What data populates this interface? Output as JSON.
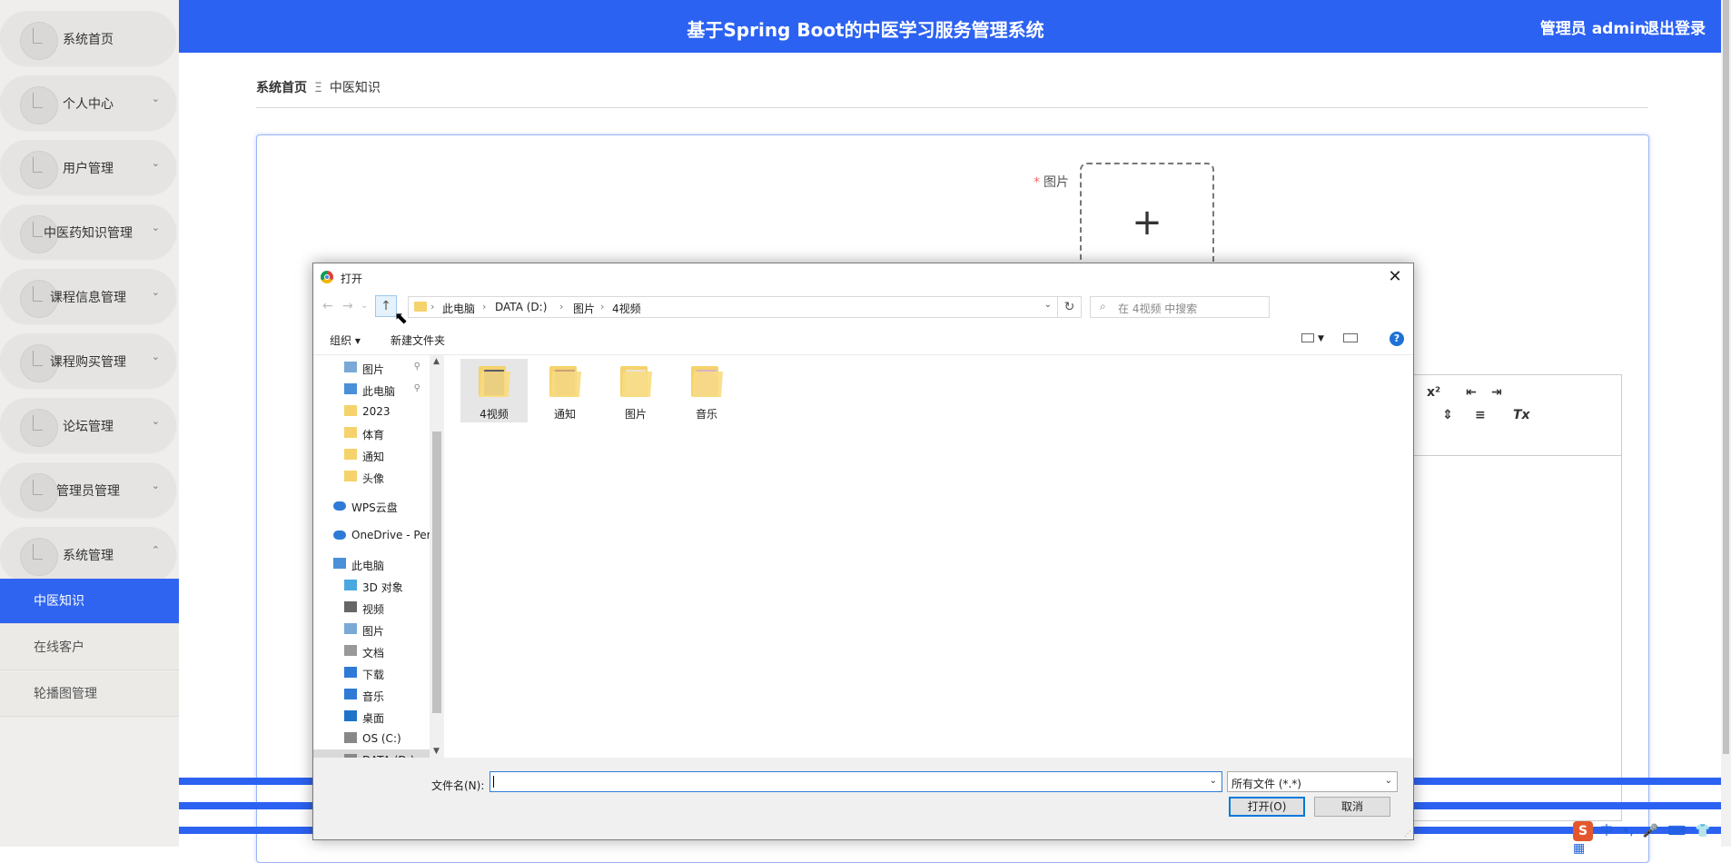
{
  "sidebar": {
    "menus": [
      {
        "label": "系统首页",
        "chevron": ""
      },
      {
        "label": "个人中心",
        "chevron": "⌄"
      },
      {
        "label": "用户管理",
        "chevron": "⌄"
      },
      {
        "label": "中医药知识管理",
        "chevron": "⌄"
      },
      {
        "label": "课程信息管理",
        "chevron": "⌄"
      },
      {
        "label": "课程购买管理",
        "chevron": "⌄"
      },
      {
        "label": "论坛管理",
        "chevron": "⌄"
      },
      {
        "label": "管理员管理",
        "chevron": "⌄"
      },
      {
        "label": "系统管理",
        "chevron": "⌃"
      }
    ],
    "subitems": [
      {
        "label": "中医知识",
        "active": true
      },
      {
        "label": "在线客户",
        "active": false
      },
      {
        "label": "轮播图管理",
        "active": false
      }
    ]
  },
  "header": {
    "title": "基于Spring Boot的中医学习服务管理系统",
    "user": "管理员 admin",
    "logout": "退出登录"
  },
  "breadcrumb": {
    "home": "系统首页",
    "separator": "Ξ",
    "current": "中医知识"
  },
  "form": {
    "image_label": "图片",
    "required_mark": "*",
    "upload_plus": "+"
  },
  "editor": {
    "sup": "x²",
    "clear": "Tx"
  },
  "dialog": {
    "title": "打开",
    "close": "✕",
    "nav": {
      "back": "←",
      "forward": "→",
      "recent": "⌄",
      "up": "↑",
      "refresh": "↻"
    },
    "address": {
      "crumbs": [
        "此电脑",
        "DATA (D:)",
        "图片",
        "4视频"
      ],
      "separator": "›",
      "dropdown": "⌄"
    },
    "search_placeholder": "在 4视频 中搜索",
    "toolbar": {
      "organize": "组织 ▾",
      "new_folder": "新建文件夹",
      "help": "?"
    },
    "navpane": [
      {
        "label": "图片",
        "type": "pictures",
        "pinned": true,
        "indent": 1
      },
      {
        "label": "此电脑",
        "type": "pc",
        "pinned": true,
        "indent": 1
      },
      {
        "label": "2023",
        "type": "folder",
        "pinned": false,
        "indent": 1
      },
      {
        "label": "体育",
        "type": "folder",
        "pinned": false,
        "indent": 1
      },
      {
        "label": "通知",
        "type": "folder",
        "pinned": false,
        "indent": 1
      },
      {
        "label": "头像",
        "type": "folder",
        "pinned": false,
        "indent": 1
      },
      {
        "label": "WPS云盘",
        "type": "cloud",
        "pinned": false,
        "indent": 0
      },
      {
        "label": "OneDrive - Perso",
        "type": "cloud",
        "pinned": false,
        "indent": 0
      },
      {
        "label": "此电脑",
        "type": "pc",
        "pinned": false,
        "indent": 0
      },
      {
        "label": "3D 对象",
        "type": "3d",
        "pinned": false,
        "indent": 1
      },
      {
        "label": "视频",
        "type": "video",
        "pinned": false,
        "indent": 1
      },
      {
        "label": "图片",
        "type": "pictures",
        "pinned": false,
        "indent": 1
      },
      {
        "label": "文档",
        "type": "doc",
        "pinned": false,
        "indent": 1
      },
      {
        "label": "下载",
        "type": "download",
        "pinned": false,
        "indent": 1
      },
      {
        "label": "音乐",
        "type": "music",
        "pinned": false,
        "indent": 1
      },
      {
        "label": "桌面",
        "type": "desktop",
        "pinned": false,
        "indent": 1
      },
      {
        "label": "OS (C:)",
        "type": "drive",
        "pinned": false,
        "indent": 1
      },
      {
        "label": "DATA (D:)",
        "type": "drive",
        "pinned": false,
        "indent": 1,
        "selected": true
      }
    ],
    "files": [
      {
        "name": "4视频",
        "selected": true,
        "preview": "#5a5a66"
      },
      {
        "name": "通知",
        "selected": false,
        "preview": "#c9a07a"
      },
      {
        "name": "图片",
        "selected": false,
        "preview": "#e9e4d4"
      },
      {
        "name": "音乐",
        "selected": false,
        "preview": "#d9b4c2"
      }
    ],
    "filename_label": "文件名(N):",
    "filename_value": "",
    "filetype": "所有文件 (*.*)",
    "open_button": "打开(O)",
    "cancel_button": "取消"
  },
  "ime": {
    "logo": "S",
    "items": [
      "中",
      "•,",
      "🎤",
      "⌨",
      "👕",
      "▦"
    ]
  },
  "colors": {
    "primary": "#2c62f2",
    "sidebar_bg": "#efeeec",
    "dialog_select": "#cde8ff"
  }
}
